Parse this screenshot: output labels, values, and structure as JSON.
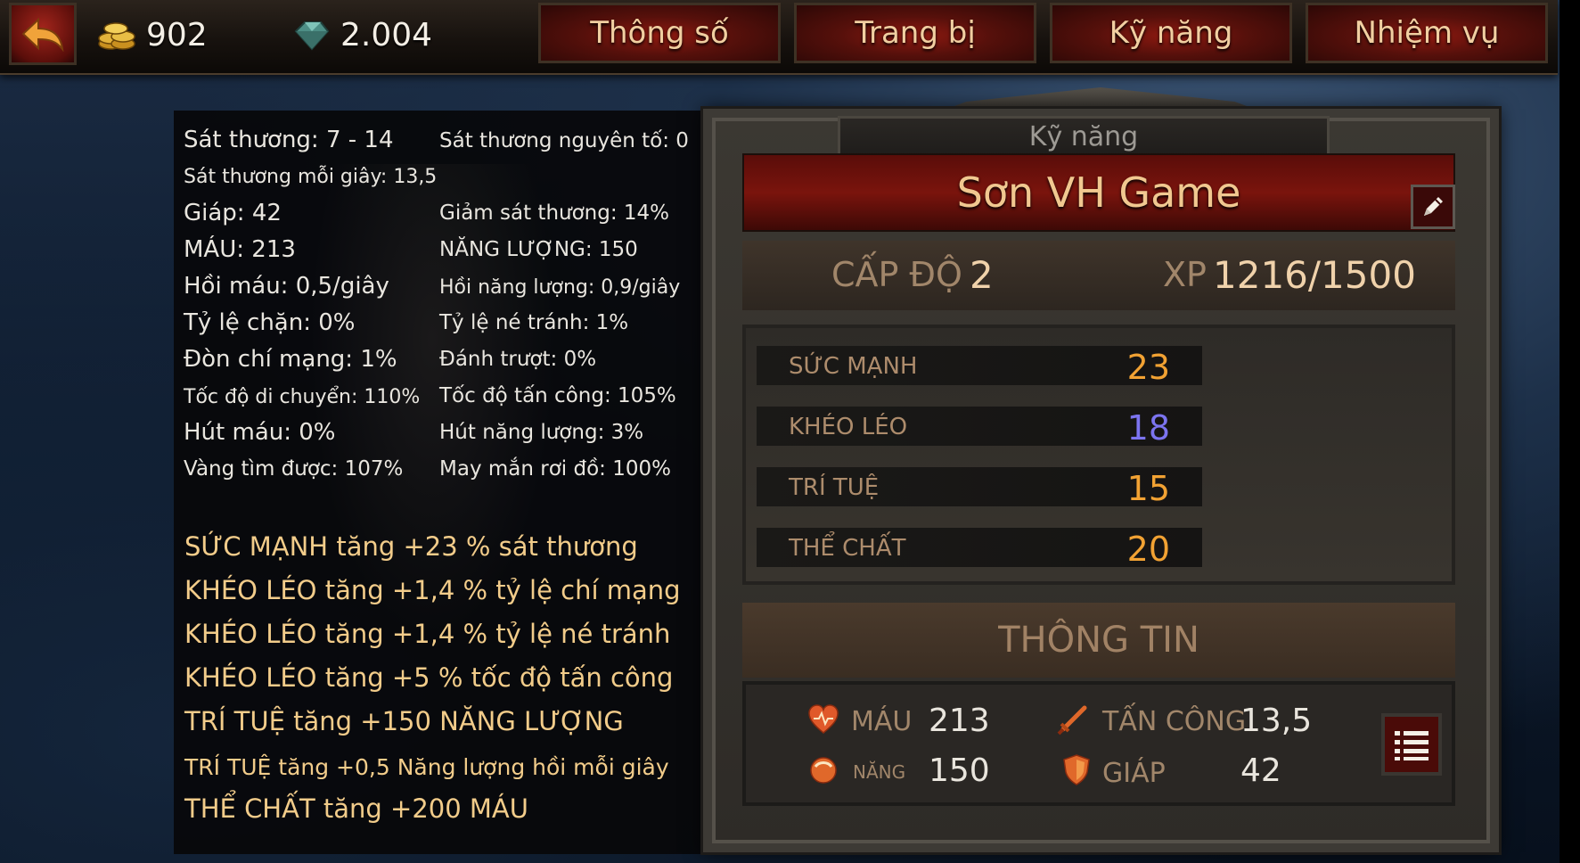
{
  "topbar": {
    "gold": "902",
    "gems": "2.004",
    "tabs": [
      "Thông số",
      "Trang bị",
      "Kỹ năng",
      "Nhiệm vụ"
    ]
  },
  "stats": {
    "damage": "Sát thương: 7 - 14",
    "elemental_damage": "Sát thương nguyên tố: 0",
    "dps": "Sát thương mỗi giây: 13,5",
    "armor": "Giáp: 42",
    "damage_reduction": "Giảm sát thương: 14%",
    "health": "MÁU: 213",
    "energy": "NĂNG LƯỢNG: 150",
    "health_regen": "Hồi máu: 0,5/giây",
    "energy_regen": "Hồi năng lượng: 0,9/giây",
    "block_chance": "Tỷ lệ chặn: 0%",
    "dodge_chance": "Tỷ lệ né tránh: 1%",
    "crit_chance": "Đòn chí mạng: 1%",
    "glancing_blow": "Đánh trượt: 0%",
    "move_speed": "Tốc độ di chuyển: 110%",
    "attack_speed": "Tốc độ tấn công: 105%",
    "life_steal": "Hút máu: 0%",
    "energy_steal": "Hút năng lượng: 3%",
    "gold_find": "Vàng tìm được: 107%",
    "magic_find": "May mắn rơi đồ: 100%"
  },
  "bonuses": [
    "SỨC MẠNH tăng +23 % sát thương",
    "KHÉO LÉO tăng +1,4 % tỷ lệ chí mạng",
    "KHÉO LÉO tăng +1,4 % tỷ lệ né tránh",
    "KHÉO LÉO tăng +5 % tốc độ tấn công",
    "TRÍ TUỆ tăng +150 NĂNG LƯỢNG",
    "TRÍ TUỆ tăng +0,5 Năng lượng hồi mỗi giây",
    "THỂ CHẤT tăng +200 MÁU"
  ],
  "character": {
    "panel_title": "Kỹ năng",
    "name": "Sơn VH Game",
    "level_label": "CẤP ĐỘ",
    "level": "2",
    "xp_label": "XP",
    "xp": "1216/1500",
    "attributes": [
      {
        "name": "SỨC MẠNH",
        "value": "23",
        "color": "#f2a233"
      },
      {
        "name": "KHÉO LÉO",
        "value": "18",
        "color": "#7c74f0"
      },
      {
        "name": "TRÍ TUỆ",
        "value": "15",
        "color": "#f2a233"
      },
      {
        "name": "THỂ CHẤT",
        "value": "20",
        "color": "#f2a233"
      }
    ]
  },
  "info": {
    "header": "THÔNG TIN",
    "health_label": "MÁU",
    "health": "213",
    "energy_label": "NĂNG",
    "energy": "150",
    "attack_label": "TẤN CÔNG",
    "attack": "13,5",
    "armor_label": "GIÁP",
    "armor": "42"
  },
  "icons": [
    "back-arrow-icon",
    "gold-coins-icon",
    "gem-icon",
    "pencil-icon",
    "heart-icon",
    "energy-orb-icon",
    "sword-icon",
    "shield-icon",
    "list-icon"
  ]
}
